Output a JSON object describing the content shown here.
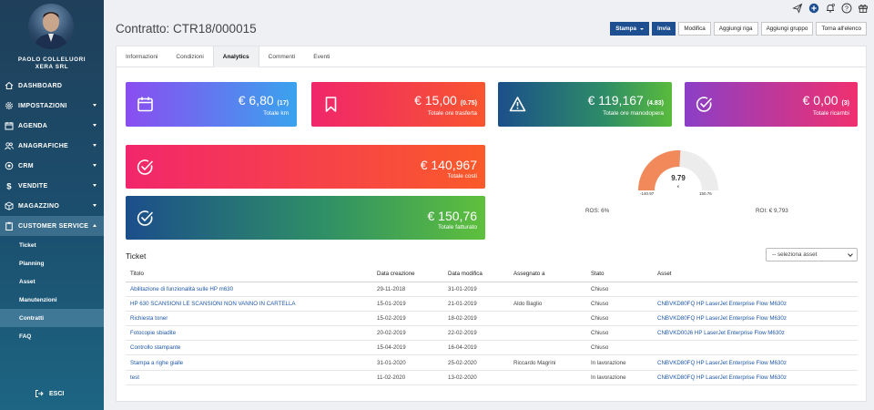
{
  "user": {
    "name_line1": "PAOLO COLLELUORI",
    "name_line2": "XERA SRL"
  },
  "nav": {
    "items": [
      {
        "label": "DASHBOARD",
        "icon": "home-icon",
        "caret": false
      },
      {
        "label": "IMPOSTAZIONI",
        "icon": "gear-icon",
        "caret": true
      },
      {
        "label": "AGENDA",
        "icon": "calendar-icon",
        "caret": true
      },
      {
        "label": "ANAGRAFICHE",
        "icon": "users-icon",
        "caret": true
      },
      {
        "label": "CRM",
        "icon": "target-icon",
        "caret": true
      },
      {
        "label": "VENDITE",
        "icon": "dollar-icon",
        "caret": true
      },
      {
        "label": "MAGAZZINO",
        "icon": "cube-icon",
        "caret": true
      },
      {
        "label": "CUSTOMER SERVICE",
        "icon": "clipboard-icon",
        "caret": true
      }
    ],
    "sub_items": [
      "Ticket",
      "Planning",
      "Asset",
      "Manutenzioni",
      "Contratti",
      "FAQ"
    ],
    "logout": "ESCI"
  },
  "topbar": {
    "icons": [
      "send-icon",
      "add-circle-icon",
      "bell-icon",
      "help-icon",
      "gift-icon"
    ]
  },
  "page": {
    "title": "Contratto: CTR18/000015"
  },
  "actions": {
    "stampa": "Stampa",
    "invia": "Invia",
    "modifica": "Modifica",
    "aggiungi_riga": "Aggiungi riga",
    "aggiungi_gruppo": "Aggiungi gruppo",
    "torna": "Torna all'elenco"
  },
  "tabs": [
    "Informazioni",
    "Condizioni",
    "Analytics",
    "Commenti",
    "Eventi"
  ],
  "stats": {
    "km": {
      "value": "€ 6,80",
      "count": "(17)",
      "label": "Totale km",
      "icon": "calendar-icon"
    },
    "trasferta": {
      "value": "€ 15,00",
      "count": "(0.75)",
      "label": "Totale ore trasferta",
      "icon": "bookmark-icon"
    },
    "manodopera": {
      "value": "€ 119,167",
      "count": "(4.83)",
      "label": "Totale ore manodopera",
      "icon": "warning-icon"
    },
    "ricambi": {
      "value": "€ 0,00",
      "count": "(3)",
      "label": "Totale ricambi",
      "icon": "check-circle-icon"
    },
    "costi": {
      "value": "€ 140,967",
      "label": "Totale costi",
      "icon": "check-circle-icon"
    },
    "fatturato": {
      "value": "€ 150,76",
      "label": "Totale fatturato",
      "icon": "check-circle-icon"
    }
  },
  "gauge": {
    "center": "9.79",
    "unit": "€",
    "min_label": "-140.97",
    "max_label": "150.76",
    "min": -140.97,
    "max": 150.76,
    "value": 9.79,
    "fill_color": "#f2895b",
    "track_color": "#ececec"
  },
  "ros": {
    "left": "ROS: 6%",
    "right": "ROI: € 9,793"
  },
  "ticket": {
    "title": "Ticket",
    "select_placeholder": "-- seleziona asset",
    "columns": [
      "Titolo",
      "Data creazione",
      "Data modifica",
      "Assegnato a",
      "Stato",
      "Asset"
    ],
    "rows": [
      [
        "Abilitazione di funzionalità sulle HP m630",
        "29-11-2018",
        "31-01-2019",
        "",
        "Chiuso",
        ""
      ],
      [
        "HP 630 SCANSIONI LE SCANSIONI NON VANNO IN CARTELLA",
        "15-01-2019",
        "21-01-2019",
        "Aldo Baglio",
        "Chiuso",
        "CNBVKD80FQ HP LaserJet Enterprise Flow M630z"
      ],
      [
        "Richiesta toner",
        "15-02-2019",
        "18-02-2019",
        "",
        "Chiuso",
        "CNBVKD80FQ HP LaserJet Enterprise Flow M630z"
      ],
      [
        "Fotocopie sbiadite",
        "20-02-2019",
        "22-02-2019",
        "",
        "Chiuso",
        "CNBVKD00J6 HP LaserJet Enterprise Flow M630z"
      ],
      [
        "Controllo stampante",
        "15-04-2019",
        "16-04-2019",
        "",
        "Chiuso",
        ""
      ],
      [
        "Stampa a righe gialle",
        "31-01-2020",
        "25-02-2020",
        "Riccardo Magrini",
        "In lavorazione",
        "CNBVKD80FQ HP LaserJet Enterprise Flow M630z"
      ],
      [
        "test",
        "11-02-2020",
        "13-02-2020",
        "",
        "In lavorazione",
        "CNBVKD80FQ HP LaserJet Enterprise Flow M630z"
      ]
    ]
  }
}
